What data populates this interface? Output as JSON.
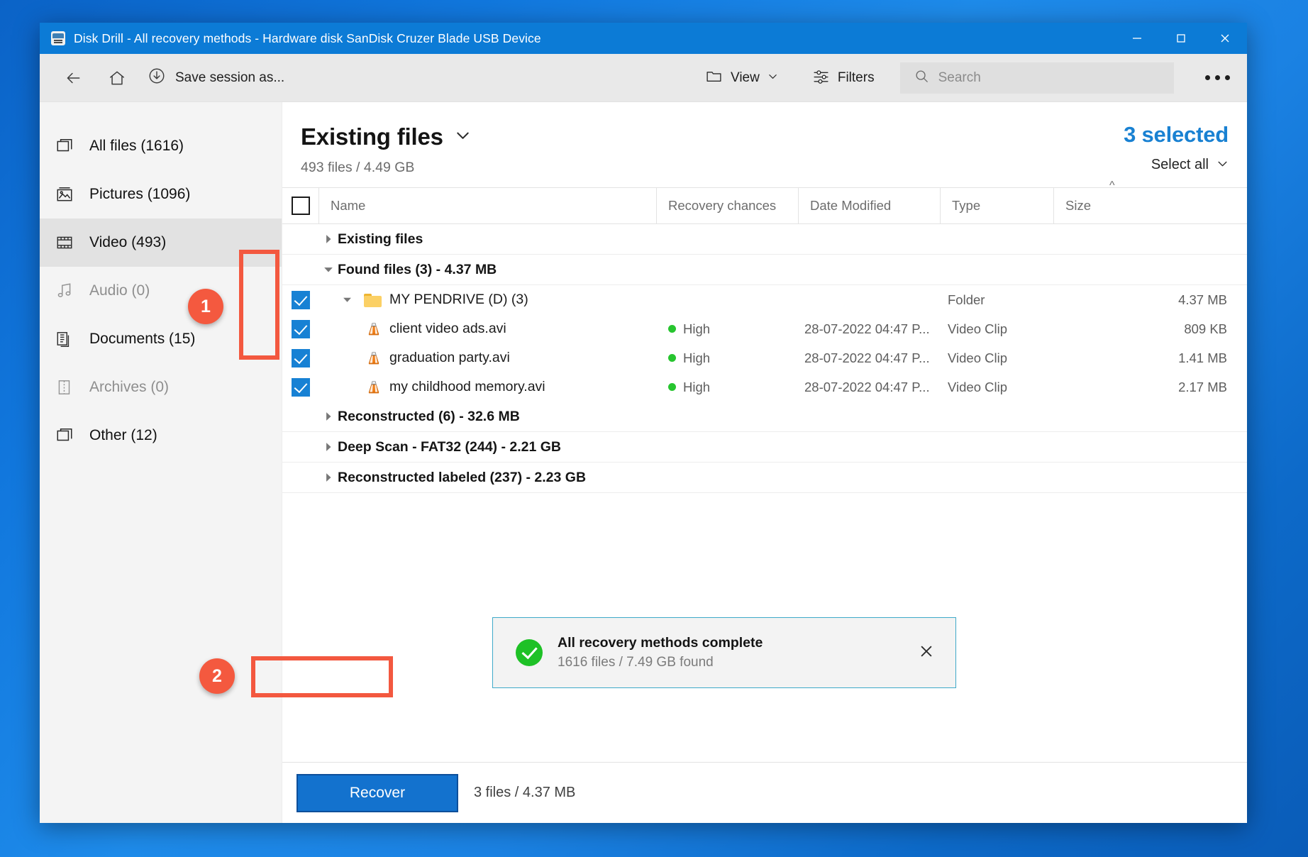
{
  "window": {
    "title": "Disk Drill - All recovery methods - Hardware disk SanDisk Cruzer Blade USB Device",
    "app_icon": "disk-drill-icon",
    "controls": {
      "minimize": "minimize-icon",
      "maximize": "maximize-icon",
      "close": "close-icon"
    },
    "titlebar_color": "#0c7bd6"
  },
  "toolbar": {
    "back": "back-arrow-icon",
    "home": "home-icon",
    "save_session_icon": "download-arrow-icon",
    "save_session_label": "Save session as...",
    "view_icon": "folder-icon",
    "view_label": "View",
    "view_chevron": "chevron-down-icon",
    "filters_icon": "sliders-icon",
    "filters_label": "Filters",
    "search_icon": "search-icon",
    "search_placeholder": "Search",
    "search_value": "",
    "overflow_label": "more-options-icon"
  },
  "sidebar": {
    "items": [
      {
        "label": "All files (1616)",
        "icon": "files-icon",
        "active": false,
        "disabled": false
      },
      {
        "label": "Pictures (1096)",
        "icon": "picture-icon",
        "active": false,
        "disabled": false
      },
      {
        "label": "Video (493)",
        "icon": "film-icon",
        "active": true,
        "disabled": false
      },
      {
        "label": "Audio (0)",
        "icon": "music-note-icon",
        "active": false,
        "disabled": true
      },
      {
        "label": "Documents (15)",
        "icon": "document-icon",
        "active": false,
        "disabled": false
      },
      {
        "label": "Archives (0)",
        "icon": "archive-icon",
        "active": false,
        "disabled": true
      },
      {
        "label": "Other (12)",
        "icon": "files-icon",
        "active": false,
        "disabled": false
      }
    ]
  },
  "content_header": {
    "title": "Existing files",
    "title_chevron": "chevron-down-icon",
    "subtitle": "493 files / 4.49 GB",
    "selected_count": "3 selected",
    "selected_color": "#1981d2",
    "select_all_label": "Select all",
    "select_all_chevron": "chevron-down-icon"
  },
  "table": {
    "header_checkbox_checked": false,
    "columns": [
      "Name",
      "Recovery chances",
      "Date Modified",
      "Type",
      "Size"
    ],
    "sort_caret": "^",
    "sorted_column": "Size",
    "rows": [
      {
        "kind": "group",
        "twisty": "collapsed",
        "indent": 0,
        "name": "Existing files",
        "checkbox": null,
        "recovery": "",
        "date": "",
        "type": "",
        "size": ""
      },
      {
        "kind": "group",
        "twisty": "expanded",
        "indent": 0,
        "name": "Found files (3) - 4.37 MB",
        "checkbox": null,
        "recovery": "",
        "date": "",
        "type": "",
        "size": ""
      },
      {
        "kind": "folder",
        "twisty": "expanded",
        "indent": 1,
        "name": "MY PENDRIVE (D) (3)",
        "checkbox": "checked",
        "icon": "folder-icon",
        "recovery": "",
        "date": "",
        "type": "Folder",
        "size": "4.37 MB"
      },
      {
        "kind": "file",
        "twisty": "none",
        "indent": 2,
        "name": "client video ads.avi",
        "checkbox": "checked",
        "icon": "vlc-cone-icon",
        "recovery": "High",
        "date": "28-07-2022 04:47 P...",
        "type": "Video Clip",
        "size": "809 KB"
      },
      {
        "kind": "file",
        "twisty": "none",
        "indent": 2,
        "name": "graduation party.avi",
        "checkbox": "checked",
        "icon": "vlc-cone-icon",
        "recovery": "High",
        "date": "28-07-2022 04:47 P...",
        "type": "Video Clip",
        "size": "1.41 MB"
      },
      {
        "kind": "file",
        "twisty": "none",
        "indent": 2,
        "name": "my childhood memory.avi",
        "checkbox": "checked",
        "icon": "vlc-cone-icon",
        "recovery": "High",
        "date": "28-07-2022 04:47 P...",
        "type": "Video Clip",
        "size": "2.17 MB"
      },
      {
        "kind": "group",
        "twisty": "collapsed",
        "indent": 0,
        "name": "Reconstructed (6) - 32.6 MB",
        "checkbox": null,
        "recovery": "",
        "date": "",
        "type": "",
        "size": ""
      },
      {
        "kind": "group",
        "twisty": "collapsed",
        "indent": 0,
        "name": "Deep Scan - FAT32 (244) - 2.21 GB",
        "checkbox": null,
        "recovery": "",
        "date": "",
        "type": "",
        "size": ""
      },
      {
        "kind": "group",
        "twisty": "collapsed",
        "indent": 0,
        "name": "Reconstructed labeled (237) - 2.23 GB",
        "checkbox": null,
        "recovery": "",
        "date": "",
        "type": "",
        "size": ""
      }
    ],
    "recovery_dot_color": "#27c52f"
  },
  "toast": {
    "icon": "success-check-icon",
    "title": "All recovery methods complete",
    "subtitle": "1616 files / 7.49 GB found",
    "close_icon": "close-icon",
    "border_color": "#3fa9c9",
    "icon_color": "#1ec126"
  },
  "footer": {
    "recover_label": "Recover",
    "recover_color": "#1372ce",
    "info": "3 files / 4.37 MB"
  },
  "annotations": {
    "badges": [
      {
        "label": "1",
        "color": "#f4593f"
      },
      {
        "label": "2",
        "color": "#f4593f"
      }
    ],
    "highlight_color": "#f3583f"
  }
}
